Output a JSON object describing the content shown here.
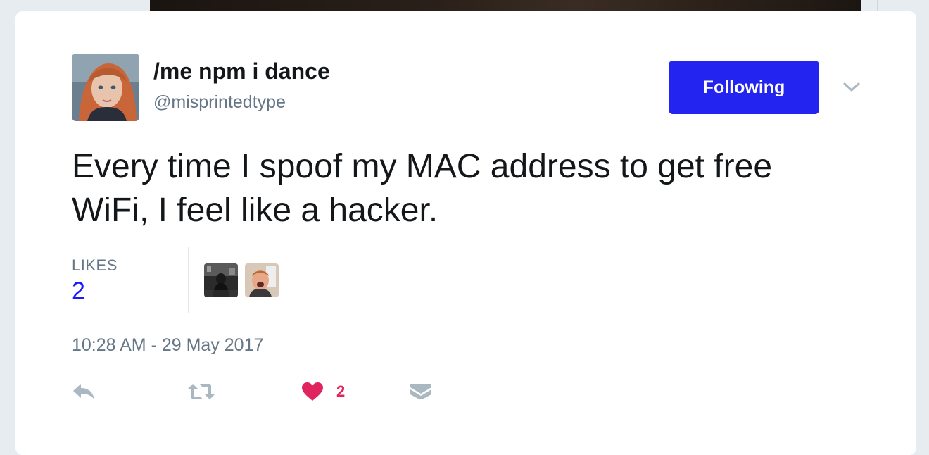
{
  "tweet": {
    "author": {
      "display_name": "/me npm i dance",
      "handle": "@misprintedtype"
    },
    "follow_button_label": "Following",
    "text_lines": [
      "Every time I spoof my MAC address to get free",
      "WiFi, I feel like a hacker."
    ],
    "stats": {
      "likes_label": "LIKES",
      "likes_count": "2"
    },
    "timestamp": "10:28 AM - 29 May 2017",
    "actions": {
      "like_count": "2"
    }
  },
  "colors": {
    "accent": "#2424f0",
    "like": "#e0245e",
    "secondary_text": "#657786",
    "count_link": "#1a1aff",
    "icon_gray": "#aab8c2"
  },
  "icons": [
    "chevron-down-icon",
    "reply-icon",
    "retweet-icon",
    "heart-icon",
    "envelope-icon"
  ]
}
